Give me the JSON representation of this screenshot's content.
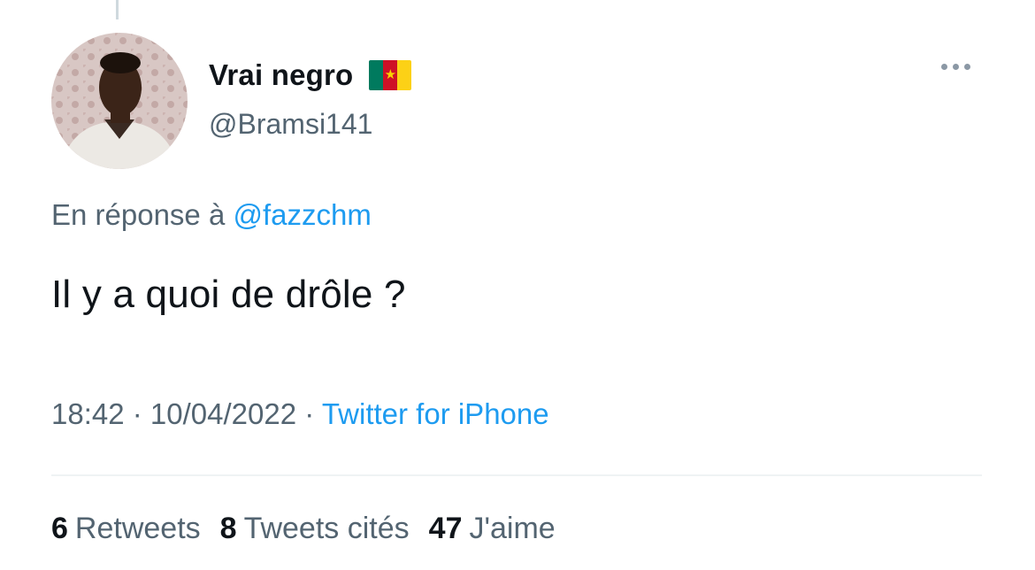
{
  "tweet": {
    "author": {
      "display_name": "Vrai negro",
      "handle": "@Bramsi141",
      "flag_colors": [
        "#007a5e",
        "#ce1126",
        "#fcd116"
      ]
    },
    "reply_prefix": "En réponse à",
    "reply_mention": "@fazzchm",
    "text": "Il y a quoi de drôle ?",
    "time": "18:42",
    "date_sep": " · ",
    "date": "10/04/2022",
    "source_sep": " · ",
    "source": "Twitter for iPhone",
    "stats": {
      "retweets_count": "6",
      "retweets_label": "Retweets",
      "quotes_count": "8",
      "quotes_label": "Tweets cités",
      "likes_count": "47",
      "likes_label": "J'aime"
    },
    "colors": {
      "accent": "#1d9bf0",
      "secondary_text": "#536471",
      "primary_text": "#0f1419"
    },
    "icons": {
      "more": "more-horizontal-icon",
      "flag": "cameroon-flag-icon"
    }
  }
}
